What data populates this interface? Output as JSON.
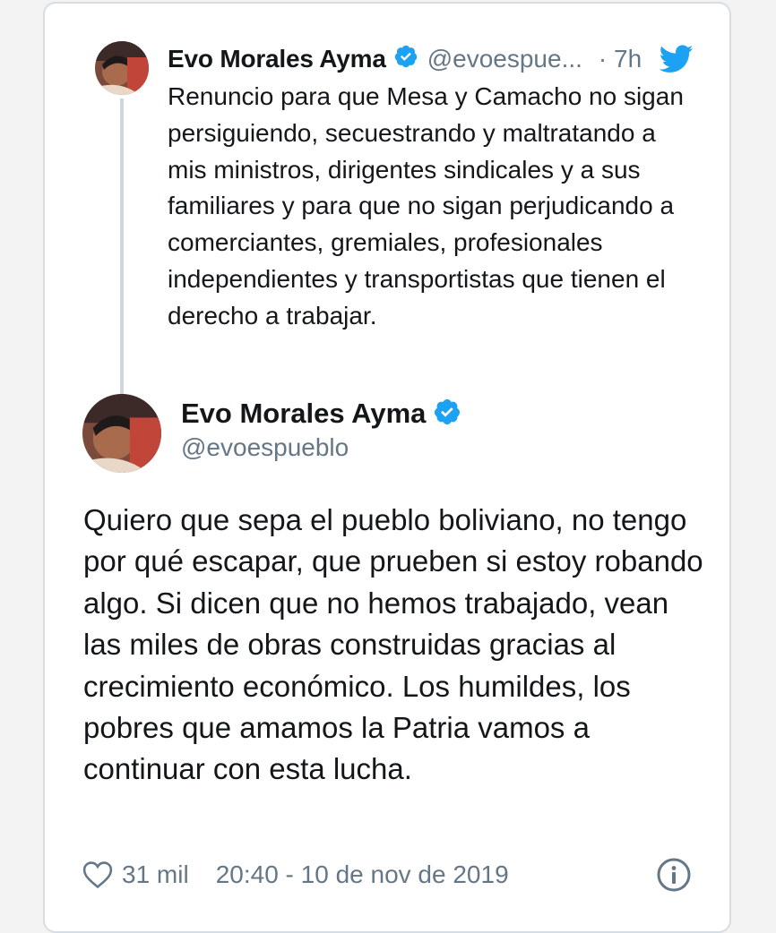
{
  "parent_tweet": {
    "author_name": "Evo Morales Ayma",
    "handle": "@evoespue...",
    "time": "· 7h",
    "text": "Renuncio para que Mesa y Camacho no sigan persiguiendo, secuestrando y maltratando a mis ministros, dirigentes sindicales y a sus familiares y para que no sigan perjudicando a comerciantes, gremiales, profesionales independientes y transportistas que tienen el derecho a trabajar."
  },
  "main_tweet": {
    "author_name": "Evo Morales Ayma",
    "handle": "@evoespueblo",
    "text": "Quiero que sepa el pueblo boliviano, no tengo por qué escapar, que prueben si estoy robando algo. Si dicen que no hemos trabajado, vean las miles de obras construidas gracias al crecimiento económico. Los humildes, los pobres que amamos la Patria vamos a continuar con esta lucha.",
    "likes": "31 mil",
    "timestamp": "20:40 - 10 de nov de 2019"
  },
  "icons": {
    "verified": "verified-badge-icon",
    "twitter": "twitter-bird-icon",
    "like": "heart-icon",
    "info": "info-icon"
  },
  "colors": {
    "accent": "#1da1f2",
    "text": "#14171a",
    "secondary_text": "#657786",
    "border": "#d6dde3",
    "background": "#f3f3f3"
  }
}
